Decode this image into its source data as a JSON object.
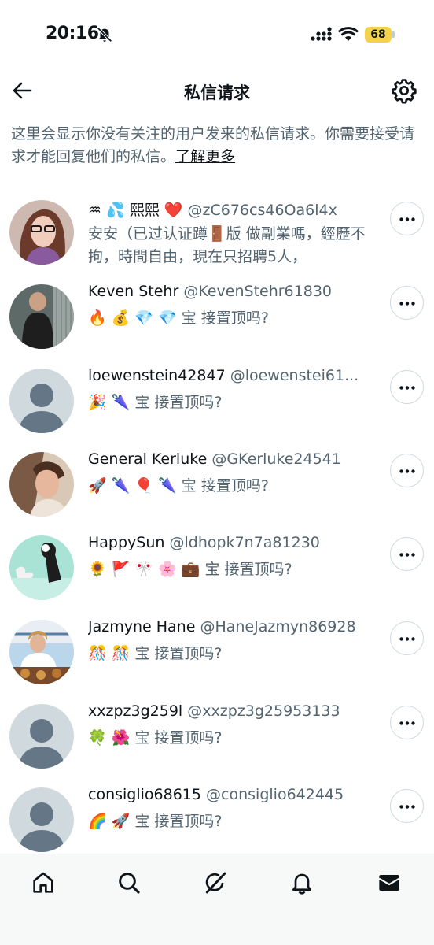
{
  "status_bar": {
    "time": "20:16",
    "battery": "68",
    "battery_color": "#f4d24a"
  },
  "header": {
    "title": "私信请求",
    "back_icon": "arrow-left-icon",
    "settings_icon": "gear-icon"
  },
  "intro": {
    "text": "这里会显示你没有关注的用户发来的私信请求。你需要接受请求才能回复他们的私信。",
    "link": "了解更多"
  },
  "requests": [
    {
      "name": "♒ 💦 熙熙 ❤️",
      "handle": "@zC676cs46Oa6l4x",
      "preview": "安安（已过认证蹲🚪版 做副業嗎，經歷不拘，時間自由，現在只招聘5人，"
    },
    {
      "name": "Keven Stehr",
      "handle": "@KevenStehr61830",
      "preview": "🔥 💰 💎 💎 宝  接置顶吗?"
    },
    {
      "name": "loewenstein42847",
      "handle": "@loewenstei61...",
      "preview": "🎉 🌂 宝  接置顶吗?"
    },
    {
      "name": "General Kerluke",
      "handle": "@GKerluke24541",
      "preview": "🚀 🌂 🎈 🌂 宝  接置顶吗?"
    },
    {
      "name": "HappySun",
      "handle": "@ldhopk7n7a81230",
      "preview": "🌻 🚩 🎌 🌸 💼 宝  接置顶吗?"
    },
    {
      "name": "Jazmyne Hane",
      "handle": "@HaneJazmyn86928",
      "preview": "🎊 🎊 宝  接置顶吗?"
    },
    {
      "name": "xxzpz3g259l",
      "handle": "@xxzpz3g25953133",
      "preview": "🍀 🌺 宝  接置顶吗?"
    },
    {
      "name": "consiglio68615",
      "handle": "@consiglio642445",
      "preview": "🌈 🚀 宝  接置顶吗?"
    }
  ],
  "tab_bar": {
    "items": [
      "home-icon",
      "search-icon",
      "grok-icon",
      "notifications-icon",
      "messages-icon"
    ],
    "active": "messages-icon"
  },
  "colors": {
    "text": "#0f1419",
    "secondary": "#536471",
    "border": "#cfd9de",
    "default_avatar": "#cfd9de"
  }
}
